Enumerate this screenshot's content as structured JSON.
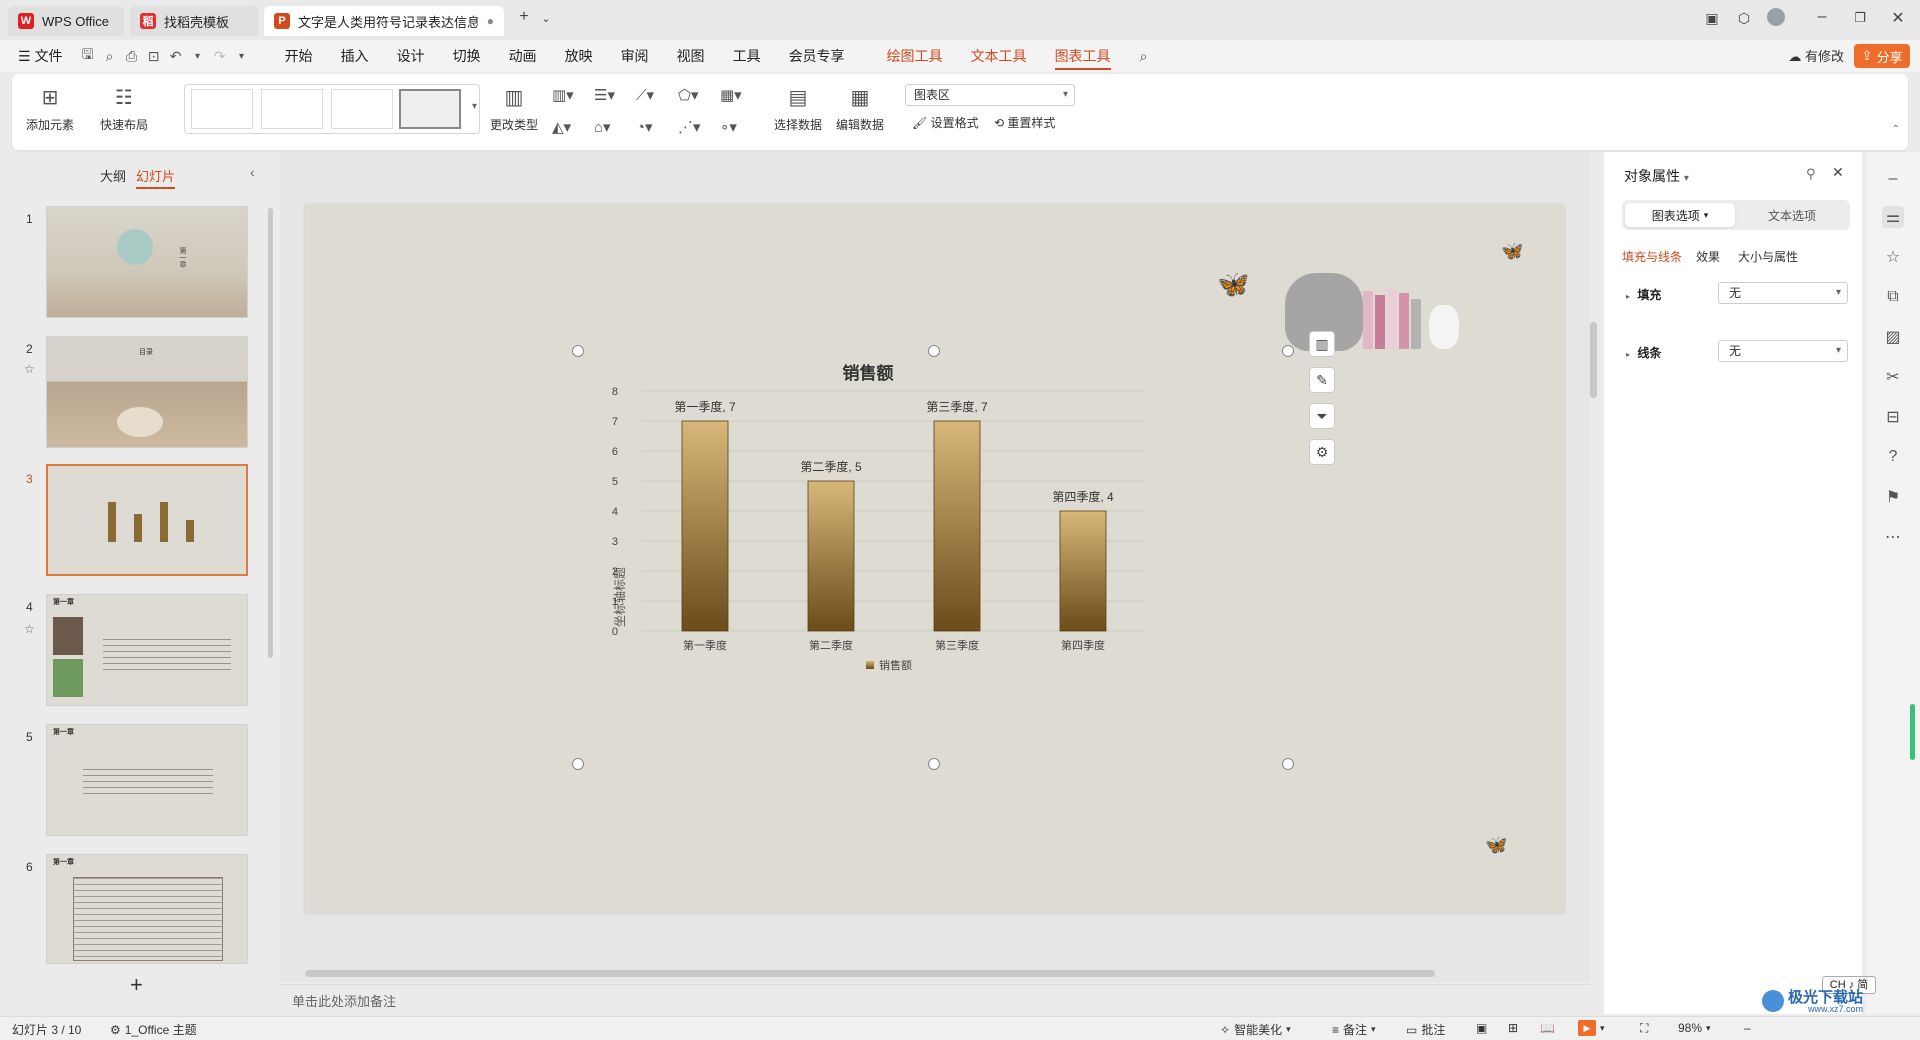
{
  "window": {
    "tabs": [
      {
        "label": "WPS Office",
        "logo": "W",
        "logo_color": "#e02020"
      },
      {
        "label": "找稻壳模板",
        "logo": "稻",
        "logo_color": "#e03030"
      },
      {
        "label": "文字是人类用符号记录表达信息以",
        "logo": "P",
        "logo_color": "#d24a1e"
      }
    ],
    "new_tab": "+"
  },
  "menu": {
    "file": "文件",
    "items": [
      "开始",
      "插入",
      "设计",
      "切换",
      "动画",
      "放映",
      "审阅",
      "视图",
      "工具",
      "会员专享"
    ],
    "context_items": [
      "绘图工具",
      "文本工具",
      "图表工具"
    ],
    "active": "图表工具",
    "modified": "有修改",
    "share": "分享"
  },
  "ribbon": {
    "add_element": "添加元素",
    "quick_layout": "快速布局",
    "change_type": "更改类型",
    "select_data": "选择数据",
    "edit_data": "编辑数据",
    "chart_area_select": "图表区",
    "set_format": "设置格式",
    "reset_style": "重置样式"
  },
  "left_panel": {
    "tab_outline": "大纲",
    "tab_slides": "幻灯片",
    "slides": [
      {
        "num": "1",
        "title": "第一章"
      },
      {
        "num": "2",
        "title": "目录"
      },
      {
        "num": "3",
        "title": ""
      },
      {
        "num": "4",
        "title": "第一章"
      },
      {
        "num": "5",
        "title": "第一章"
      },
      {
        "num": "6",
        "title": "第一章"
      }
    ],
    "add": "+"
  },
  "chart_data": {
    "type": "bar",
    "title": "销售额",
    "ylabel": "坐标轴标题",
    "categories": [
      "第一季度",
      "第二季度",
      "第三季度",
      "第四季度"
    ],
    "series": [
      {
        "name": "销售额",
        "values": [
          7,
          5,
          7,
          4
        ]
      }
    ],
    "data_labels": [
      "第一季度, 7",
      "第二季度, 5",
      "第三季度, 7",
      "第四季度, 4"
    ],
    "ylim": [
      0,
      8
    ],
    "yticks": [
      "0",
      "1",
      "2",
      "3",
      "4",
      "5",
      "6",
      "7",
      "8"
    ],
    "bar_color_top": "#d8b77a",
    "bar_color_bottom": "#6b4c1a",
    "legend": "bottom",
    "grid": true
  },
  "notes": {
    "placeholder": "单击此处添加备注"
  },
  "right_panel": {
    "title": "对象属性",
    "seg_chart": "图表选项",
    "seg_text": "文本选项",
    "sub_tabs": [
      "填充与线条",
      "效果",
      "大小与属性"
    ],
    "fill_label": "填充",
    "fill_value": "无",
    "line_label": "线条",
    "line_value": "无"
  },
  "status": {
    "slide_pos": "幻灯片 3 / 10",
    "theme": "1_Office 主题",
    "smart": "智能美化",
    "notes_btn": "备注",
    "comment": "批注",
    "zoom": "98%",
    "ime": "CH ♪ 简"
  },
  "watermark": {
    "line1": "极光下载站",
    "line2": "www.xz7.com"
  }
}
